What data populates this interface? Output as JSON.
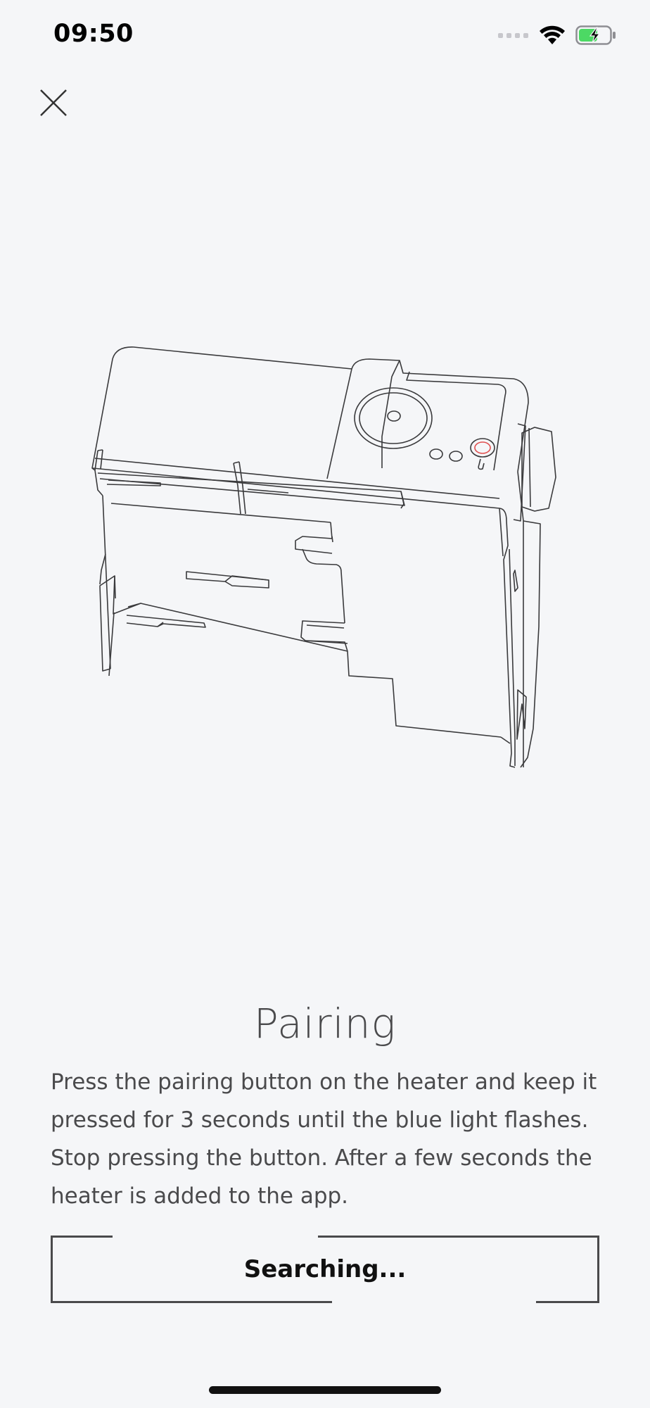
{
  "status_bar": {
    "time": "09:50",
    "icons": [
      "cellular-signal-icon",
      "wifi-icon",
      "battery-charging-icon"
    ],
    "battery_color": "#4cd964"
  },
  "header": {
    "close_icon": "close-icon"
  },
  "illustration": {
    "subject": "heater"
  },
  "content": {
    "title": "Pairing",
    "description": "Press the pairing button on the heater and keep it pressed for 3 seconds until the blue light flashes. Stop pressing the button. After a few seconds the heater is added to the app.",
    "button_label": "Searching..."
  },
  "colors": {
    "background": "#f5f6f8",
    "text": "#4a4a4c",
    "accent_red": "#e05050"
  }
}
